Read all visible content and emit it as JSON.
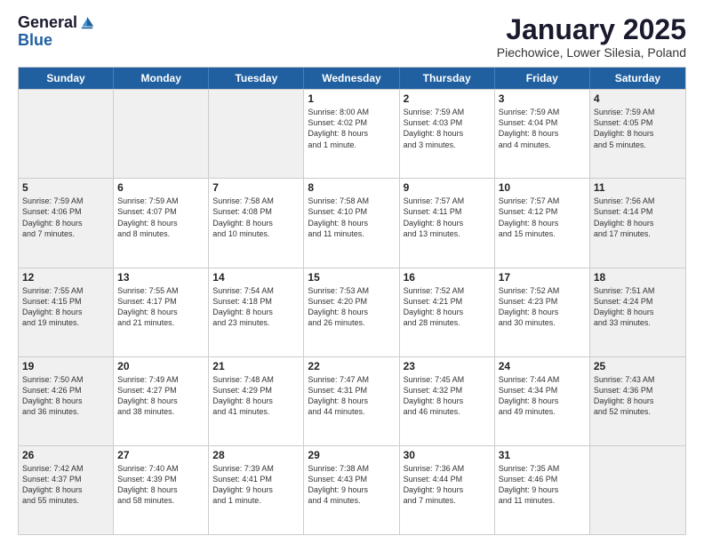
{
  "header": {
    "logo_line1": "General",
    "logo_line2": "Blue",
    "month_title": "January 2025",
    "location": "Piechowice, Lower Silesia, Poland"
  },
  "weekdays": [
    "Sunday",
    "Monday",
    "Tuesday",
    "Wednesday",
    "Thursday",
    "Friday",
    "Saturday"
  ],
  "rows": [
    [
      {
        "day": "",
        "text": "",
        "shaded": true
      },
      {
        "day": "",
        "text": "",
        "shaded": true
      },
      {
        "day": "",
        "text": "",
        "shaded": true
      },
      {
        "day": "1",
        "text": "Sunrise: 8:00 AM\nSunset: 4:02 PM\nDaylight: 8 hours\nand 1 minute.",
        "shaded": false
      },
      {
        "day": "2",
        "text": "Sunrise: 7:59 AM\nSunset: 4:03 PM\nDaylight: 8 hours\nand 3 minutes.",
        "shaded": false
      },
      {
        "day": "3",
        "text": "Sunrise: 7:59 AM\nSunset: 4:04 PM\nDaylight: 8 hours\nand 4 minutes.",
        "shaded": false
      },
      {
        "day": "4",
        "text": "Sunrise: 7:59 AM\nSunset: 4:05 PM\nDaylight: 8 hours\nand 5 minutes.",
        "shaded": true
      }
    ],
    [
      {
        "day": "5",
        "text": "Sunrise: 7:59 AM\nSunset: 4:06 PM\nDaylight: 8 hours\nand 7 minutes.",
        "shaded": true
      },
      {
        "day": "6",
        "text": "Sunrise: 7:59 AM\nSunset: 4:07 PM\nDaylight: 8 hours\nand 8 minutes.",
        "shaded": false
      },
      {
        "day": "7",
        "text": "Sunrise: 7:58 AM\nSunset: 4:08 PM\nDaylight: 8 hours\nand 10 minutes.",
        "shaded": false
      },
      {
        "day": "8",
        "text": "Sunrise: 7:58 AM\nSunset: 4:10 PM\nDaylight: 8 hours\nand 11 minutes.",
        "shaded": false
      },
      {
        "day": "9",
        "text": "Sunrise: 7:57 AM\nSunset: 4:11 PM\nDaylight: 8 hours\nand 13 minutes.",
        "shaded": false
      },
      {
        "day": "10",
        "text": "Sunrise: 7:57 AM\nSunset: 4:12 PM\nDaylight: 8 hours\nand 15 minutes.",
        "shaded": false
      },
      {
        "day": "11",
        "text": "Sunrise: 7:56 AM\nSunset: 4:14 PM\nDaylight: 8 hours\nand 17 minutes.",
        "shaded": true
      }
    ],
    [
      {
        "day": "12",
        "text": "Sunrise: 7:55 AM\nSunset: 4:15 PM\nDaylight: 8 hours\nand 19 minutes.",
        "shaded": true
      },
      {
        "day": "13",
        "text": "Sunrise: 7:55 AM\nSunset: 4:17 PM\nDaylight: 8 hours\nand 21 minutes.",
        "shaded": false
      },
      {
        "day": "14",
        "text": "Sunrise: 7:54 AM\nSunset: 4:18 PM\nDaylight: 8 hours\nand 23 minutes.",
        "shaded": false
      },
      {
        "day": "15",
        "text": "Sunrise: 7:53 AM\nSunset: 4:20 PM\nDaylight: 8 hours\nand 26 minutes.",
        "shaded": false
      },
      {
        "day": "16",
        "text": "Sunrise: 7:52 AM\nSunset: 4:21 PM\nDaylight: 8 hours\nand 28 minutes.",
        "shaded": false
      },
      {
        "day": "17",
        "text": "Sunrise: 7:52 AM\nSunset: 4:23 PM\nDaylight: 8 hours\nand 30 minutes.",
        "shaded": false
      },
      {
        "day": "18",
        "text": "Sunrise: 7:51 AM\nSunset: 4:24 PM\nDaylight: 8 hours\nand 33 minutes.",
        "shaded": true
      }
    ],
    [
      {
        "day": "19",
        "text": "Sunrise: 7:50 AM\nSunset: 4:26 PM\nDaylight: 8 hours\nand 36 minutes.",
        "shaded": true
      },
      {
        "day": "20",
        "text": "Sunrise: 7:49 AM\nSunset: 4:27 PM\nDaylight: 8 hours\nand 38 minutes.",
        "shaded": false
      },
      {
        "day": "21",
        "text": "Sunrise: 7:48 AM\nSunset: 4:29 PM\nDaylight: 8 hours\nand 41 minutes.",
        "shaded": false
      },
      {
        "day": "22",
        "text": "Sunrise: 7:47 AM\nSunset: 4:31 PM\nDaylight: 8 hours\nand 44 minutes.",
        "shaded": false
      },
      {
        "day": "23",
        "text": "Sunrise: 7:45 AM\nSunset: 4:32 PM\nDaylight: 8 hours\nand 46 minutes.",
        "shaded": false
      },
      {
        "day": "24",
        "text": "Sunrise: 7:44 AM\nSunset: 4:34 PM\nDaylight: 8 hours\nand 49 minutes.",
        "shaded": false
      },
      {
        "day": "25",
        "text": "Sunrise: 7:43 AM\nSunset: 4:36 PM\nDaylight: 8 hours\nand 52 minutes.",
        "shaded": true
      }
    ],
    [
      {
        "day": "26",
        "text": "Sunrise: 7:42 AM\nSunset: 4:37 PM\nDaylight: 8 hours\nand 55 minutes.",
        "shaded": true
      },
      {
        "day": "27",
        "text": "Sunrise: 7:40 AM\nSunset: 4:39 PM\nDaylight: 8 hours\nand 58 minutes.",
        "shaded": false
      },
      {
        "day": "28",
        "text": "Sunrise: 7:39 AM\nSunset: 4:41 PM\nDaylight: 9 hours\nand 1 minute.",
        "shaded": false
      },
      {
        "day": "29",
        "text": "Sunrise: 7:38 AM\nSunset: 4:43 PM\nDaylight: 9 hours\nand 4 minutes.",
        "shaded": false
      },
      {
        "day": "30",
        "text": "Sunrise: 7:36 AM\nSunset: 4:44 PM\nDaylight: 9 hours\nand 7 minutes.",
        "shaded": false
      },
      {
        "day": "31",
        "text": "Sunrise: 7:35 AM\nSunset: 4:46 PM\nDaylight: 9 hours\nand 11 minutes.",
        "shaded": false
      },
      {
        "day": "",
        "text": "",
        "shaded": true
      }
    ]
  ]
}
